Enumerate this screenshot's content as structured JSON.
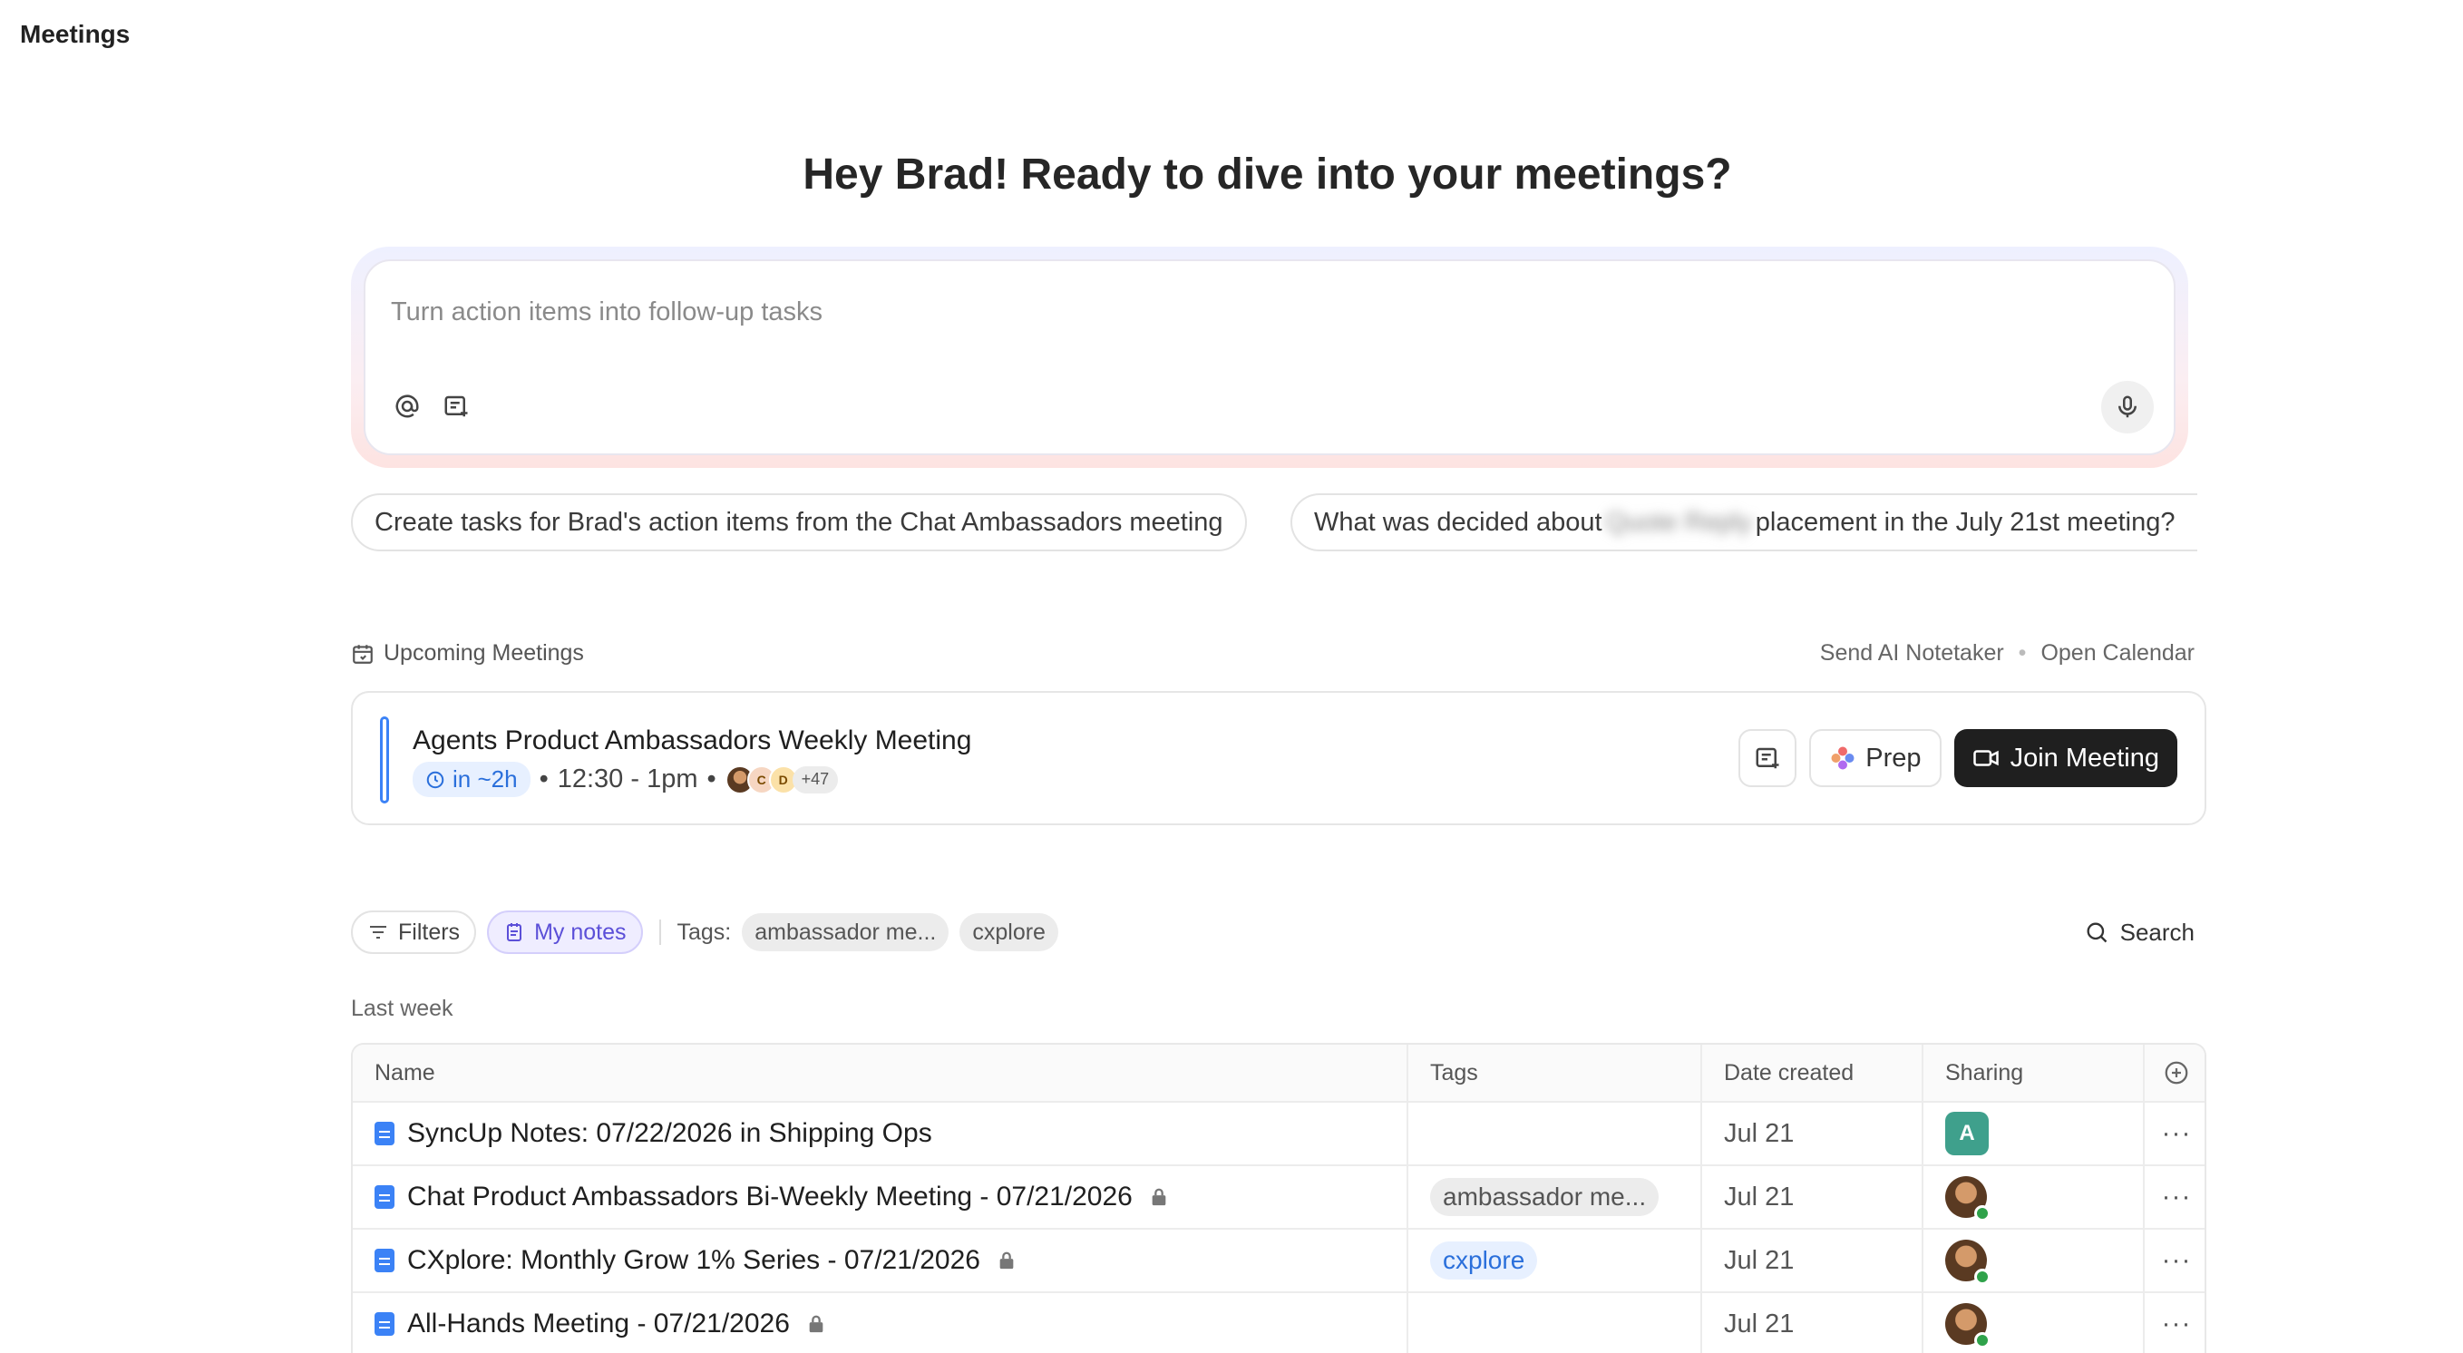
{
  "page": {
    "title": "Meetings"
  },
  "greeting": "Hey Brad! Ready to dive into your meetings?",
  "prompt": {
    "placeholder": "Turn action items into follow-up tasks"
  },
  "suggestions": [
    {
      "label": "Create tasks for Brad's action items from the Chat Ambassadors meeting"
    },
    {
      "prefix": "What was decided about",
      "blurred": "Quote Reply",
      "suffix": "placement in the July 21st meeting?"
    }
  ],
  "upcoming": {
    "heading": "Upcoming Meetings",
    "links": {
      "notetaker": "Send AI Notetaker",
      "separator": "•",
      "calendar": "Open Calendar"
    },
    "meeting": {
      "title": "Agents Product Ambassadors Weekly Meeting",
      "relative_time": "in ~2h",
      "time_range": "12:30 - 1pm",
      "bullet": "•",
      "attendee_initials": [
        "C",
        "D"
      ],
      "more_attendees": "+47",
      "prep_label": "Prep",
      "join_label": "Join Meeting"
    }
  },
  "filters": {
    "filters_label": "Filters",
    "my_notes_label": "My notes",
    "tags_label": "Tags:",
    "tags": [
      "ambassador me...",
      "cxplore"
    ],
    "search_label": "Search"
  },
  "group_label": "Last week",
  "table": {
    "columns": [
      "Name",
      "Tags",
      "Date created",
      "Sharing"
    ],
    "rows": [
      {
        "name": "SyncUp Notes: 07/22/2026 in Shipping Ops",
        "tag": "",
        "date": "Jul 21",
        "sharing": "A",
        "locked": false
      },
      {
        "name": "Chat Product Ambassadors Bi-Weekly Meeting - 07/21/2026",
        "tag": "ambassador me...",
        "date": "Jul 21",
        "sharing": "avatar",
        "locked": true
      },
      {
        "name": "CXplore: Monthly Grow 1% Series - 07/21/2026",
        "tag": "cxplore",
        "date": "Jul 21",
        "sharing": "avatar",
        "locked": true
      },
      {
        "name": "All-Hands Meeting - 07/21/2026",
        "tag": "",
        "date": "Jul 21",
        "sharing": "avatar",
        "locked": true
      }
    ],
    "more_glyph": "···"
  },
  "colors": {
    "accent": "#3b82f6",
    "join_button": "#1f1f1f",
    "my_notes": "#5b4fd8",
    "online": "#2fa24a",
    "share_badge": "#3fa08c"
  }
}
